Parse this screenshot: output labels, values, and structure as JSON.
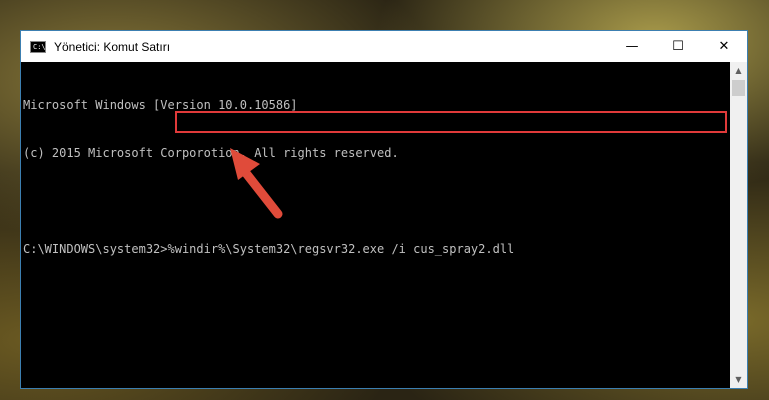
{
  "window": {
    "title": "Yönetici: Komut Satırı",
    "icon_text": "C:\\",
    "controls": {
      "minimize": "—",
      "maximize": "☐",
      "close": "✕"
    }
  },
  "console": {
    "lines": [
      "Microsoft Windows [Version 10.0.10586]",
      "(c) 2015 Microsoft Corporotion. All rights reserved.",
      "",
      "C:\\WINDOWS\\system32>%windir%\\System32\\regsvr32.exe /i cus_spray2.dll"
    ]
  },
  "colors": {
    "highlight": "#e03a3a",
    "console_text": "#c0c0c0",
    "console_bg": "#000000"
  },
  "icons": [
    "cmd-icon",
    "scroll-up-icon",
    "scroll-down-icon",
    "arrow-pointer-icon"
  ]
}
